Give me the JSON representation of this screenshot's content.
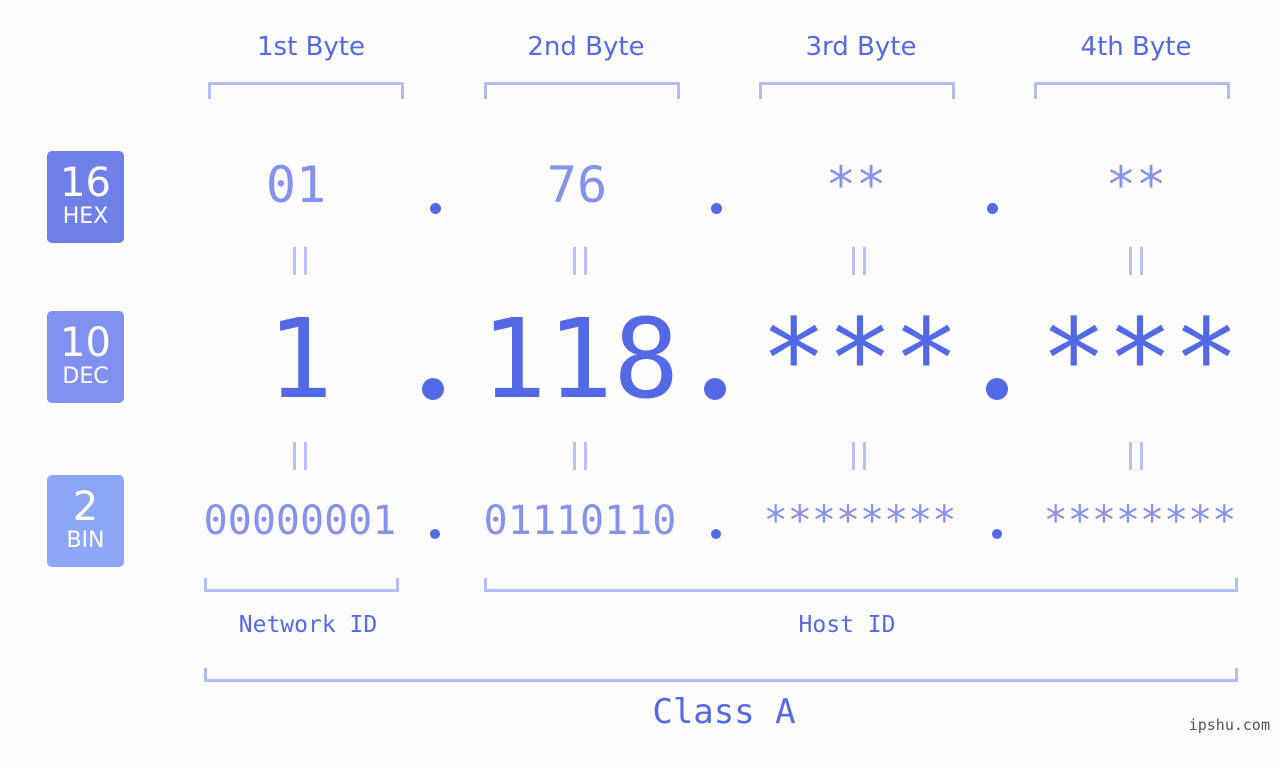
{
  "bytes": {
    "headers": [
      "1st Byte",
      "2nd Byte",
      "3rd Byte",
      "4th Byte"
    ]
  },
  "badges": {
    "hex": {
      "num": "16",
      "label": "HEX"
    },
    "dec": {
      "num": "10",
      "label": "DEC"
    },
    "bin": {
      "num": "2",
      "label": "BIN"
    }
  },
  "hex": [
    "01",
    "76",
    "**",
    "**"
  ],
  "dec": [
    "1",
    "118",
    "***",
    "***"
  ],
  "bin": [
    "00000001",
    "01110110",
    "********",
    "********"
  ],
  "separator": ".",
  "equals_symbol": "||",
  "network_id_label": "Network ID",
  "host_id_label": "Host ID",
  "class_label": "Class A",
  "watermark": "ipshu.com",
  "colors": {
    "accent": "#5469e6",
    "light_text": "#8592ee",
    "bracket": "#b2bcf7",
    "badge_hex": "#6f7fea",
    "badge_dec": "#8191f0",
    "badge_bin": "#8ea6f8"
  }
}
